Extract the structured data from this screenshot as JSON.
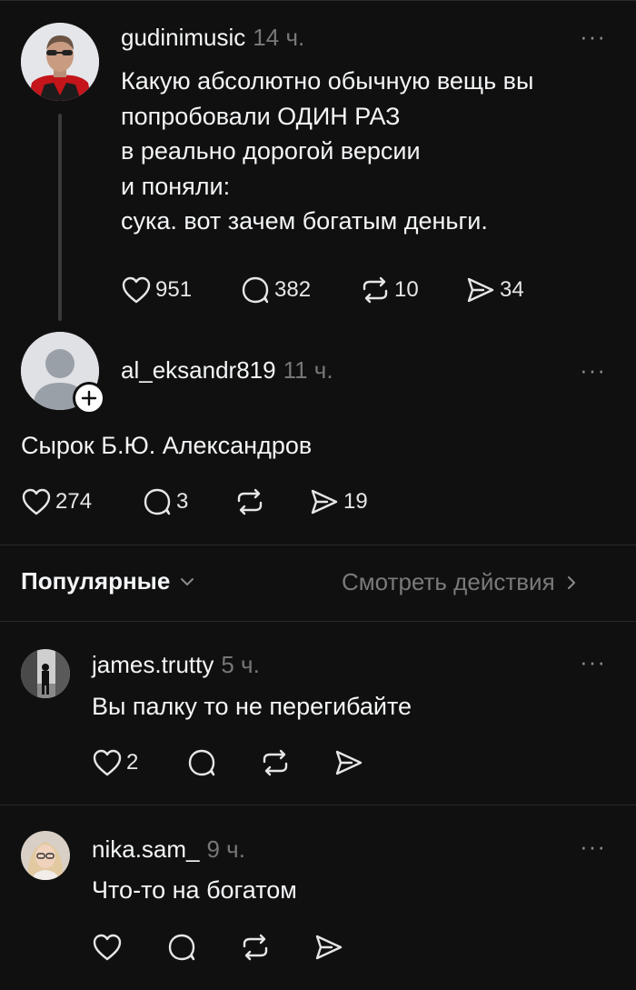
{
  "main_post": {
    "username": "gudinimusic",
    "time": "14 ч.",
    "more": "···",
    "text": "Какую абсолютно обычную вещь вы\nпопробовали ОДИН РАЗ\nв реально дорогой версии\nи поняли:\nсука. вот зачем богатым деньги.",
    "likes": "951",
    "comments": "382",
    "reposts": "10",
    "shares": "34"
  },
  "reply": {
    "username": "al_eksandr819",
    "time": "11 ч.",
    "more": "···",
    "text": "Сырок Б.Ю. Александров",
    "likes": "274",
    "comments": "3",
    "shares": "19"
  },
  "filter": {
    "label": "Популярные",
    "activity_link": "Смотреть действия"
  },
  "comments": [
    {
      "username": "james.trutty",
      "time": "5 ч.",
      "more": "···",
      "text": "Вы палку то не перегибайте",
      "likes": "2"
    },
    {
      "username": "nika.sam_",
      "time": "9 ч.",
      "more": "···",
      "text": "Что-то на богатом"
    }
  ],
  "icons": [
    "heart-icon",
    "comment-icon",
    "repost-icon",
    "share-icon",
    "chevron-down-icon",
    "chevron-right-icon",
    "plus-icon",
    "more-icon"
  ],
  "colors": {
    "background": "#101010",
    "text": "#f3f5f7",
    "muted": "#777777",
    "divider": "#2a2a2a"
  }
}
